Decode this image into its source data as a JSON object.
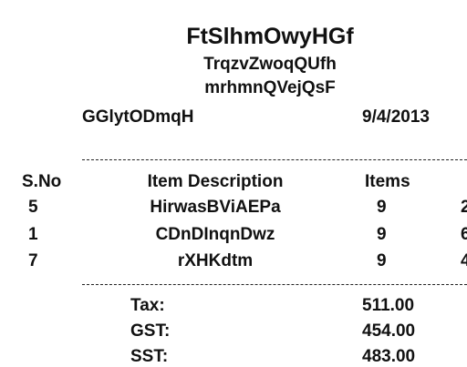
{
  "receipt": {
    "store_name": "FtSlhmOwyHGf",
    "subtitle_1": "TrqzvZwoqQUfh",
    "subtitle_2": "mrhmnQVejQsF",
    "cashier": "GGlytODmqH",
    "date": "9/4/2013",
    "columns": {
      "sno": "S.No",
      "description": "Item Description",
      "items": "Items",
      "extra": ""
    },
    "rows": [
      {
        "sno": "5",
        "description": "HirwasBViAEPa",
        "items": "9",
        "extra": "2"
      },
      {
        "sno": "1",
        "description": "CDnDInqnDwz",
        "items": "9",
        "extra": "6"
      },
      {
        "sno": "7",
        "description": "rXHKdtm",
        "items": "9",
        "extra": "4"
      }
    ],
    "totals": [
      {
        "label": "Tax:",
        "value": "511.00"
      },
      {
        "label": "GST:",
        "value": "454.00"
      },
      {
        "label": "SST:",
        "value": "483.00"
      }
    ]
  }
}
